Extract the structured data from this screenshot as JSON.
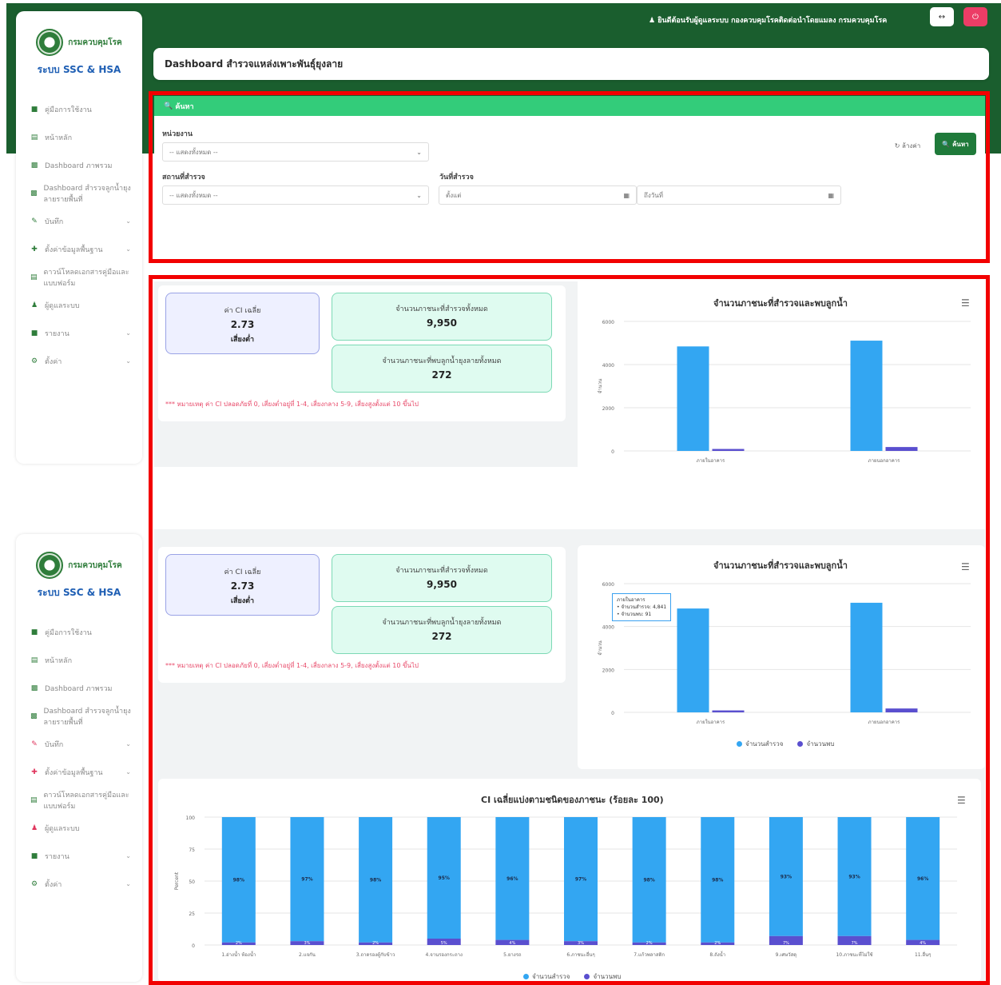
{
  "brand": {
    "logo_text": "กรมควบคุมโรค",
    "system_title": "ระบบ SSC & HSA"
  },
  "sidebar": {
    "items": [
      {
        "label": "คู่มือการใช้งาน",
        "icon": "book-icon",
        "chevron": false
      },
      {
        "label": "หน้าหลัก",
        "icon": "home-icon",
        "chevron": false
      },
      {
        "label": "Dashboard ภาพรวม",
        "icon": "chart-icon",
        "chevron": false
      },
      {
        "label": "Dashboard สำรวจลูกน้ำยุงลายรายพื้นที่",
        "icon": "chart-icon",
        "chevron": false
      },
      {
        "label": "บันทึก",
        "icon": "edit-icon",
        "chevron": true
      },
      {
        "label": "ตั้งค่าข้อมูลพื้นฐาน",
        "icon": "settings-icon",
        "chevron": true
      },
      {
        "label": "ดาวน์โหลดเอกสารคู่มือและแบบฟอร์ม",
        "icon": "document-icon",
        "chevron": false
      },
      {
        "label": "ผู้ดูแลระบบ",
        "icon": "user-icon",
        "chevron": false
      },
      {
        "label": "รายงาน",
        "icon": "report-icon",
        "chevron": true
      },
      {
        "label": "ตั้งค่า",
        "icon": "gear-icon",
        "chevron": true
      }
    ]
  },
  "header": {
    "user_text": "ยินดีต้อนรับผู้ดูแลระบบ กองควบคุมโรคติดต่อนำโดยแมลง กรมควบคุมโรค",
    "page_title": "Dashboard สำรวจแหล่งเพาะพันธุ์ยุงลาย"
  },
  "search": {
    "header": "ค้นหา",
    "unit_label": "หน่วยงาน",
    "unit_value": "-- แสดงทั้งหมด --",
    "place_label": "สถานที่สำรวจ",
    "place_value": "-- แสดงทั้งหมด --",
    "date_label": "วันที่สำรวจ",
    "date_from_placeholder": "ตั้งแต่",
    "date_to_placeholder": "ถึงวันที่",
    "reset_label": "ล้างค่า",
    "search_label": "ค้นหา"
  },
  "stats": {
    "ci_label": "ค่า CI เฉลี่ย",
    "ci_value": "2.73",
    "ci_level": "เสี่ยงต่ำ",
    "surveyed_label": "จำนวนภาชนะที่สำรวจทั้งหมด",
    "surveyed_value": "9,950",
    "found_label": "จำนวนภาชนะที่พบลูกน้ำยุงลายทั้งหมด",
    "found_value": "272",
    "note": "*** หมายเหตุ ค่า CI ปลอดภัยที่ 0, เสี่ยงต่ำอยู่ที่ 1-4, เสี่ยงกลาง 5-9, เสี่ยงสูงตั้งแต่ 10 ขึ้นไป"
  },
  "tooltip": {
    "lines": [
      "ภายในอาคาร",
      "• จำนวนสำรวจ: 4,841",
      "• จำนวนพบ: 91"
    ]
  },
  "colors": {
    "header_green": "#1a5e2e",
    "search_green": "#33cc7a",
    "surveyed_blue": "#33a6f2",
    "found_purple": "#5a4fcf",
    "highlight_red": "#f20000"
  },
  "chart_data": [
    {
      "type": "bar",
      "title": "จำนวนภาชนะที่สำรวจและพบลูกน้ำ",
      "ylabel": "จำนวน",
      "categories": [
        "ภายในอาคาร",
        "ภายนอกอาคาร"
      ],
      "ylim": [
        0,
        6000
      ],
      "yticks": [
        0,
        2000,
        4000,
        6000
      ],
      "series": [
        {
          "name": "จำนวนสำรวจ",
          "values": [
            4841,
            5109
          ]
        },
        {
          "name": "จำนวนพบ",
          "values": [
            91,
            181
          ]
        }
      ]
    },
    {
      "type": "bar",
      "title": "CI เฉลี่ยแบ่งตามชนิดของภาชนะ (ร้อยละ 100)",
      "ylabel": "Percent",
      "stacked_percent": true,
      "ylim": [
        0,
        100
      ],
      "yticks": [
        0,
        25,
        50,
        75,
        100
      ],
      "categories": [
        "1.อ่างน้ำ ห้องน้ำ",
        "2.แจกัน",
        "3.ถาดรองตู้กับข้าว",
        "4.จานรองกระถาง",
        "5.ยางรถ",
        "6.ภาชนะอื่นๆ",
        "7.แก้วพลาสติก",
        "8.ถังน้ำ",
        "9.เศษวัสดุ",
        "10.ภาชนะที่ไม่ใช้",
        "11.อื่นๆ"
      ],
      "series": [
        {
          "name": "จำนวนสำรวจ",
          "values": [
            98,
            97,
            98,
            95,
            96,
            97,
            98,
            98,
            93,
            93,
            96
          ]
        },
        {
          "name": "จำนวนพบ",
          "values": [
            2,
            3,
            2,
            5,
            4,
            3,
            2,
            2,
            7,
            7,
            4
          ]
        }
      ],
      "data_labels": [
        [
          "98%",
          "2%"
        ],
        [
          "97%",
          "3%"
        ],
        [
          "98%",
          "2%"
        ],
        [
          "95%",
          "5%"
        ],
        [
          "96%",
          "4%"
        ],
        [
          "97%",
          "3%"
        ],
        [
          "98%",
          "2%"
        ],
        [
          "98%",
          "2%"
        ],
        [
          "93%",
          "7%"
        ],
        [
          "93%",
          "7%"
        ],
        [
          "96%",
          "4%"
        ]
      ]
    }
  ]
}
